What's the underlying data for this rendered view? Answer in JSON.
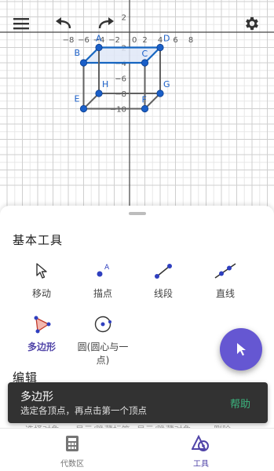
{
  "graph": {
    "x_ticks": [
      "−8",
      "−6",
      "−4",
      "−2",
      "0",
      "2",
      "4",
      "6",
      "8"
    ],
    "y_ticks": [
      "2",
      "−2",
      "−4",
      "−6",
      "−8",
      "−10"
    ],
    "points": [
      {
        "label": "A",
        "x": -4,
        "y": -2
      },
      {
        "label": "B",
        "x": -6,
        "y": -4
      },
      {
        "label": "C",
        "x": 2,
        "y": -4
      },
      {
        "label": "D",
        "x": 4,
        "y": -2
      },
      {
        "label": "E",
        "x": -6,
        "y": -10
      },
      {
        "label": "F",
        "x": 2,
        "y": -10
      },
      {
        "label": "G",
        "x": 4,
        "y": -8
      },
      {
        "label": "H",
        "x": -4,
        "y": -8
      }
    ],
    "colors": {
      "accent": "#1565c0",
      "point": "#1a5fc8",
      "polygon_fill": "#dfe8f7",
      "edge": "#616161"
    }
  },
  "sheet": {
    "basic_tools_title": "基本工具",
    "edit_title": "编辑",
    "tools": [
      {
        "name": "move",
        "label": "移动"
      },
      {
        "name": "point",
        "label": "描点"
      },
      {
        "name": "segment",
        "label": "线段"
      },
      {
        "name": "line",
        "label": "直线"
      },
      {
        "name": "polygon",
        "label": "多边形"
      },
      {
        "name": "circle",
        "label": "圆(圆心与一点)"
      }
    ],
    "edit_peek": [
      "选择对象",
      "显示/隐藏标签",
      "显示/隐藏对象",
      "删除"
    ]
  },
  "snackbar": {
    "title": "多边形",
    "text": "选定各顶点，再点击第一个顶点",
    "action": "帮助"
  },
  "bottom_nav": {
    "algebra": "代数区",
    "tools": "工具"
  },
  "colors": {
    "accent": "#6557d2",
    "active_text": "#5145a8",
    "snackbar_bg": "#323232",
    "snackbar_action": "#3bb57e"
  }
}
